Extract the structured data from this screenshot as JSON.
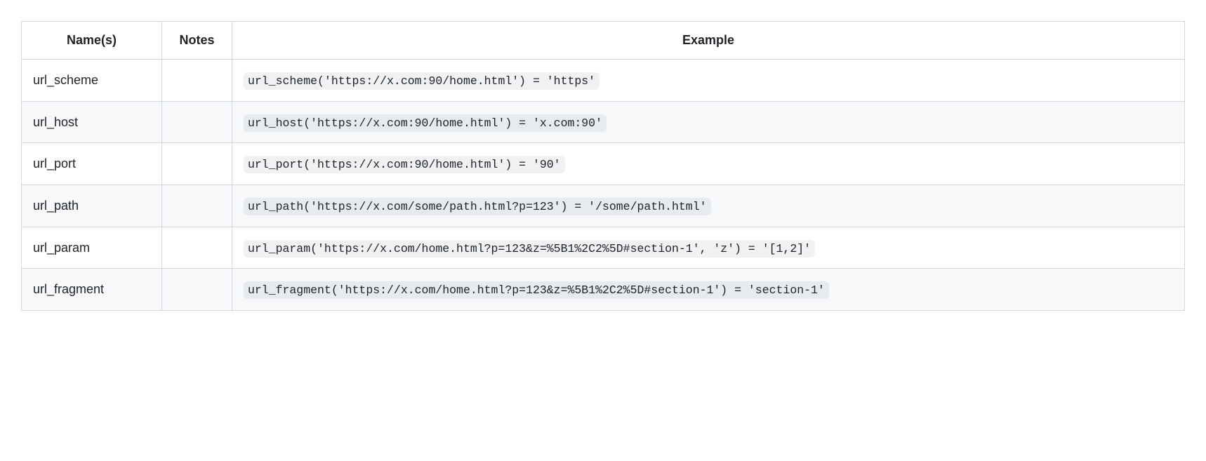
{
  "table": {
    "headers": {
      "names": "Name(s)",
      "notes": "Notes",
      "example": "Example"
    },
    "rows": [
      {
        "name": "url_scheme",
        "notes": "",
        "example": "url_scheme('https://x.com:90/home.html') = 'https'"
      },
      {
        "name": "url_host",
        "notes": "",
        "example": "url_host('https://x.com:90/home.html') = 'x.com:90'"
      },
      {
        "name": "url_port",
        "notes": "",
        "example": "url_port('https://x.com:90/home.html') = '90'"
      },
      {
        "name": "url_path",
        "notes": "",
        "example": "url_path('https://x.com/some/path.html?p=123') = '/some/path.html'"
      },
      {
        "name": "url_param",
        "notes": "",
        "example": "url_param('https://x.com/home.html?p=123&z=%5B1%2C2%5D#section-1', 'z') = '[1,2]'"
      },
      {
        "name": "url_fragment",
        "notes": "",
        "example": "url_fragment('https://x.com/home.html?p=123&z=%5B1%2C2%5D#section-1') = 'section-1'"
      }
    ]
  }
}
